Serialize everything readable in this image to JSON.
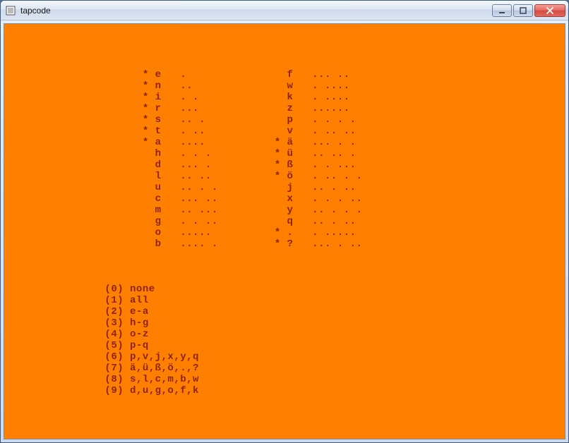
{
  "window": {
    "title": "tapcode"
  },
  "table": {
    "left": [
      {
        "mark": "*",
        "letter": "e",
        "code": "."
      },
      {
        "mark": "*",
        "letter": "n",
        "code": ".."
      },
      {
        "mark": "*",
        "letter": "i",
        "code": ". ."
      },
      {
        "mark": "*",
        "letter": "r",
        "code": "..."
      },
      {
        "mark": "*",
        "letter": "s",
        "code": ".. ."
      },
      {
        "mark": "*",
        "letter": "t",
        "code": ". .."
      },
      {
        "mark": "*",
        "letter": "a",
        "code": "...."
      },
      {
        "mark": " ",
        "letter": "h",
        "code": ". . ."
      },
      {
        "mark": " ",
        "letter": "d",
        "code": "... ."
      },
      {
        "mark": " ",
        "letter": "l",
        "code": ".. .."
      },
      {
        "mark": " ",
        "letter": "u",
        "code": ".. . ."
      },
      {
        "mark": " ",
        "letter": "c",
        "code": "... .."
      },
      {
        "mark": " ",
        "letter": "m",
        "code": ".. ..."
      },
      {
        "mark": " ",
        "letter": "g",
        "code": ". . .."
      },
      {
        "mark": " ",
        "letter": "o",
        "code": "....."
      },
      {
        "mark": " ",
        "letter": "b",
        "code": ".... ."
      }
    ],
    "right": [
      {
        "mark": " ",
        "letter": "f",
        "code": "... .."
      },
      {
        "mark": " ",
        "letter": "w",
        "code": ". ...."
      },
      {
        "mark": " ",
        "letter": "k",
        "code": ". ...."
      },
      {
        "mark": " ",
        "letter": "z",
        "code": "......"
      },
      {
        "mark": " ",
        "letter": "p",
        "code": ". . . ."
      },
      {
        "mark": " ",
        "letter": "v",
        "code": ". .. .."
      },
      {
        "mark": "*",
        "letter": "ä",
        "code": "... . ."
      },
      {
        "mark": "*",
        "letter": "ü",
        "code": ".. .. ."
      },
      {
        "mark": "*",
        "letter": "ß",
        "code": ". . ..."
      },
      {
        "mark": "*",
        "letter": "ö",
        "code": ". .. . ."
      },
      {
        "mark": " ",
        "letter": "j",
        "code": ".. . .."
      },
      {
        "mark": " ",
        "letter": "x",
        "code": ". . . .."
      },
      {
        "mark": " ",
        "letter": "y",
        "code": ".. . . ."
      },
      {
        "mark": " ",
        "letter": "q",
        "code": ".. . .."
      },
      {
        "mark": "*",
        "letter": ".",
        "code": ". ....."
      },
      {
        "mark": "*",
        "letter": "?",
        "code": "... . .."
      }
    ]
  },
  "menu": [
    {
      "key": "0",
      "label": "none"
    },
    {
      "key": "1",
      "label": "all"
    },
    {
      "key": "2",
      "label": "e-a"
    },
    {
      "key": "3",
      "label": "h-g"
    },
    {
      "key": "4",
      "label": "o-z"
    },
    {
      "key": "5",
      "label": "p-q"
    },
    {
      "key": "6",
      "label": "p,v,j,x,y,q"
    },
    {
      "key": "7",
      "label": "ä,ü,ß,ö,.,?"
    },
    {
      "key": "8",
      "label": "s,l,c,m,b,w"
    },
    {
      "key": "9",
      "label": "d,u,g,o,f,k"
    }
  ]
}
